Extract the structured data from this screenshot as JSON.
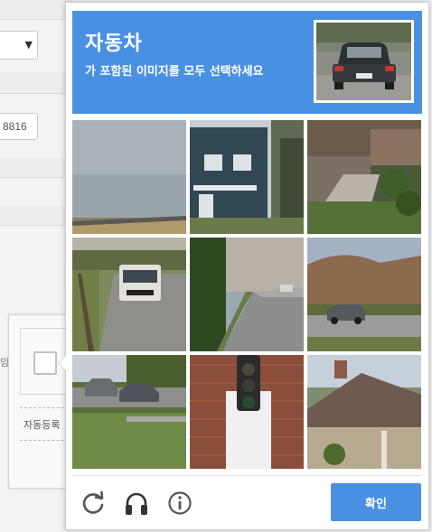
{
  "background": {
    "field_value": "8816",
    "side_mark": "임"
  },
  "anchor": {
    "label": "자동등록"
  },
  "challenge": {
    "title": "자동차",
    "subtitle": "가 포함된 이미지를 모두 선택하세요",
    "sample_image": "car-rear-photo",
    "tiles": [
      "empty-highway-field",
      "house-with-trees",
      "stone-steps-porch",
      "bus-on-road",
      "curving-road-trees",
      "car-on-hillside-road",
      "parked-cars-lawn",
      "traffic-light-brick",
      "house-roof"
    ],
    "tools": [
      "reload-icon",
      "audio-headphones-icon",
      "info-icon"
    ],
    "verify_label": "확인"
  },
  "colors": {
    "accent": "#4a90e2",
    "popup_bg": "#ffffff"
  }
}
